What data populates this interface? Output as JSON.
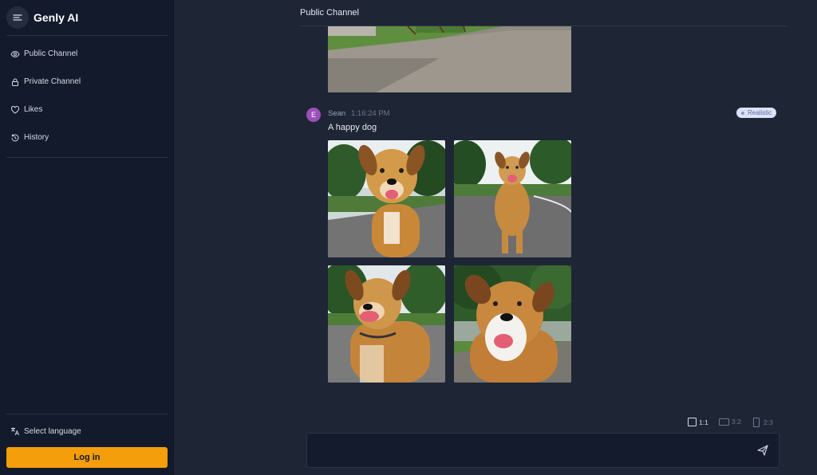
{
  "app": {
    "name": "Genly AI"
  },
  "sidebar": {
    "items": [
      {
        "label": "Public Channel",
        "icon": "eye-icon"
      },
      {
        "label": "Private Channel",
        "icon": "lock-icon"
      },
      {
        "label": "Likes",
        "icon": "heart-icon"
      },
      {
        "label": "History",
        "icon": "history-icon"
      }
    ],
    "language_label": "Select language",
    "login_label": "Log in"
  },
  "header": {
    "title": "Public Channel"
  },
  "message": {
    "avatar_letter": "E",
    "author": "Sean",
    "time": "1:16:24 PM",
    "text": "A happy dog",
    "style_badge": "Realistic",
    "images": [
      {
        "alt": "golden dog on road"
      },
      {
        "alt": "golden dog sitting on road"
      },
      {
        "alt": "golden dog smiling"
      },
      {
        "alt": "golden dog with white chest"
      }
    ]
  },
  "ratios": [
    {
      "label": "1:1",
      "selected": true
    },
    {
      "label": "3:2",
      "selected": false
    },
    {
      "label": "2:3",
      "selected": false
    }
  ],
  "prompt": {
    "value": "",
    "placeholder": ""
  },
  "colors": {
    "accent": "#f59e0b",
    "sidebar_bg": "#131a2b",
    "main_bg": "#1e2535",
    "avatar": "#9b4fb8"
  }
}
